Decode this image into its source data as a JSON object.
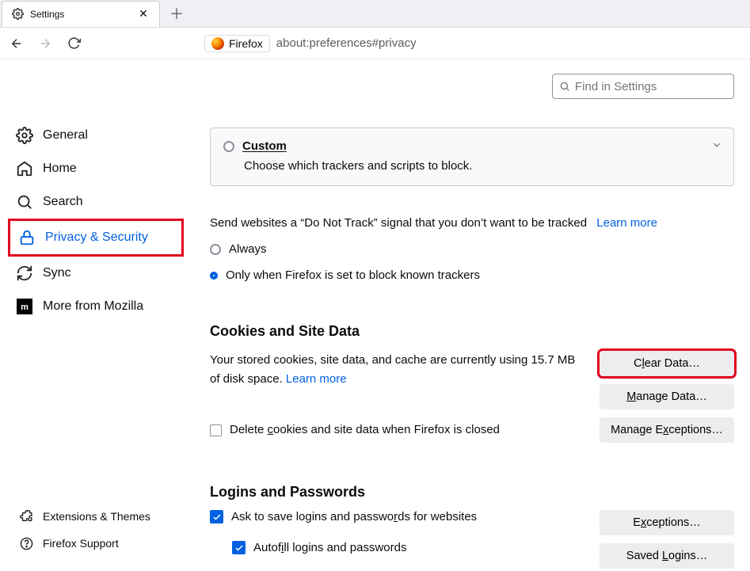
{
  "browser": {
    "tab_title": "Settings",
    "address_badge": "Firefox",
    "url": "about:preferences#privacy"
  },
  "search": {
    "placeholder": "Find in Settings"
  },
  "sidebar": {
    "items": [
      {
        "label": "General"
      },
      {
        "label": "Home"
      },
      {
        "label": "Search"
      },
      {
        "label": "Privacy & Security"
      },
      {
        "label": "Sync"
      },
      {
        "label": "More from Mozilla"
      }
    ],
    "footer": [
      {
        "label": "Extensions & Themes"
      },
      {
        "label": "Firefox Support"
      }
    ]
  },
  "custom": {
    "title": "Custom",
    "desc": "Choose which trackers and scripts to block."
  },
  "dnt": {
    "text": "Send websites a “Do Not Track” signal that you don’t want to be tracked",
    "learn": "Learn more",
    "opt_always": "Always",
    "opt_onlyblock": "Only when Firefox is set to block known trackers"
  },
  "cookies": {
    "heading": "Cookies and Site Data",
    "desc_pre": "Your stored cookies, site data, and cache are currently using ",
    "size": "15.7 MB",
    "desc_post": " of disk space.   ",
    "learn": "Learn more",
    "delete_on_close": "Delete cookies and site data when Firefox is closed",
    "btn_clear": "Clear Data…",
    "btn_manage": "Manage Data…",
    "btn_exceptions": "Manage Exceptions…"
  },
  "logins": {
    "heading": "Logins and Passwords",
    "ask_save": "Ask to save logins and passwords for websites",
    "autofill": "Autofill logins and passwords",
    "btn_exceptions": "Exceptions…",
    "btn_saved": "Saved Logins…"
  }
}
